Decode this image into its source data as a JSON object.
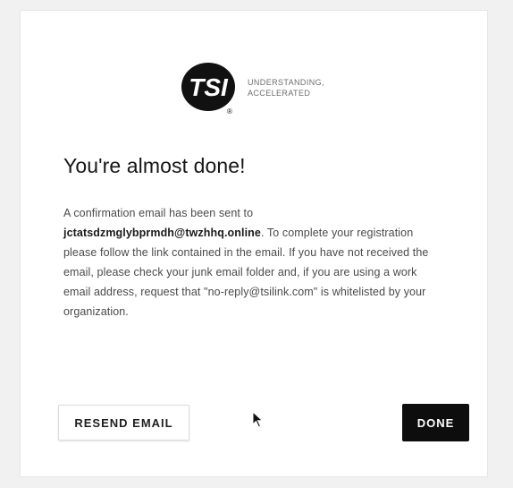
{
  "brand": {
    "logo_text": "TSI",
    "logo_registered": "®",
    "tagline_line1": "UNDERSTANDING,",
    "tagline_line2": "ACCELERATED"
  },
  "dialog": {
    "title": "You're almost done!",
    "message_part1": "A confirmation email has been sent to ",
    "email": "jctatsdzmglybprmdh@twzhhq.online",
    "message_part2": ". To complete your registration please follow the link contained in the email. If you have not received the email, please check your junk email folder and, if you are using a work email address, request that \"no-reply@tsilink.com\" is whitelisted by your organization."
  },
  "actions": {
    "resend_label": "RESEND EMAIL",
    "done_label": "DONE"
  },
  "colors": {
    "background": "#f1f1f1",
    "card": "#ffffff",
    "primary_button": "#0d0d0d",
    "text": "#161616"
  }
}
